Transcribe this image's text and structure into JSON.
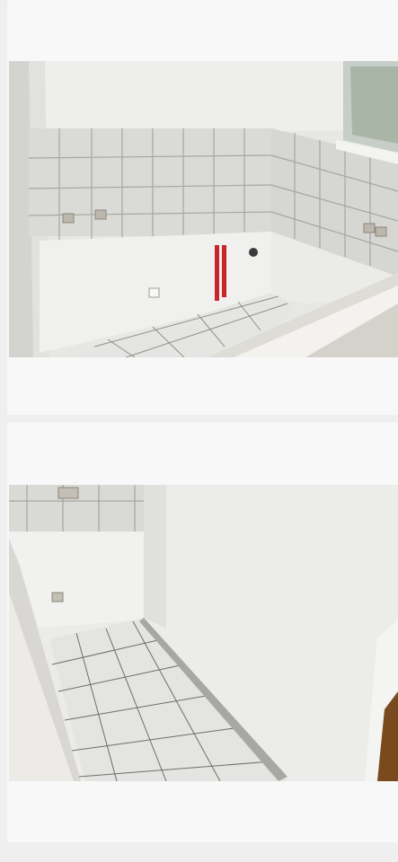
{
  "listing": {
    "photos": [
      {
        "description_id": "kitchen-alcove-tiles-pipes"
      },
      {
        "description_id": "corner-room-tiled-floor"
      }
    ]
  },
  "colors": {
    "page_bg": "#efefef",
    "card_bg": "#f8f8f8",
    "wall": "#e9e9e6",
    "tile": "#e2e2de",
    "grout": "#a7a8a4",
    "pipe": "#c8242a"
  }
}
